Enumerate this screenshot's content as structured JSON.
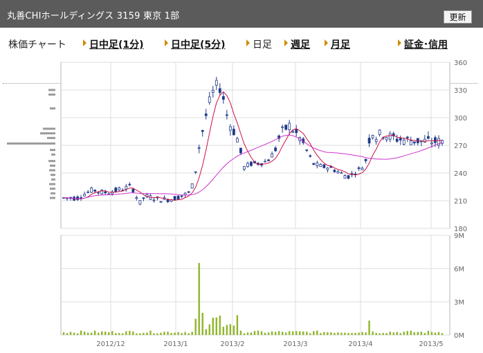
{
  "header": {
    "title": "丸善CHIホールディングス 3159 東京 1部",
    "refresh_label": "更新"
  },
  "tabs": [
    {
      "label": "株価チャート",
      "link": false,
      "arrow": false
    },
    {
      "label": "日中足(1分)",
      "link": true,
      "arrow": true
    },
    {
      "label": "日中足(5分)",
      "link": true,
      "arrow": true
    },
    {
      "label": "日足",
      "link": false,
      "arrow": true
    },
    {
      "label": "週足",
      "link": true,
      "arrow": true
    },
    {
      "label": "月足",
      "link": true,
      "arrow": true
    },
    {
      "label": "証金･信用",
      "link": true,
      "arrow": true
    }
  ],
  "colors": {
    "candle": "#1f3a8a",
    "ma_short": "#cc1144",
    "ma_long": "#cc33cc",
    "volume": "#8fb52a",
    "profile": "#9a9a9a",
    "grid": "#dddddd",
    "tab_arrow": "#d08a00",
    "header_bg": "#5b5b5b"
  },
  "chart_data": [
    {
      "type": "candlestick",
      "x_tick_labels": [
        "2012/12",
        "2013/1",
        "2013/2",
        "2013/3",
        "2013/4",
        "2013/5"
      ],
      "y_tick_labels": [
        "360",
        "330",
        "300",
        "270",
        "240",
        "210",
        "180"
      ],
      "ylim": [
        180,
        360
      ],
      "overlays": [
        "short moving average",
        "long moving average"
      ],
      "price_range_observed": [
        205,
        340
      ]
    },
    {
      "type": "bar",
      "y_tick_labels": [
        "9M",
        "6M",
        "3M",
        "0M"
      ],
      "ylim": [
        0,
        9000000
      ],
      "peak_volume_approx": 6500000
    }
  ]
}
